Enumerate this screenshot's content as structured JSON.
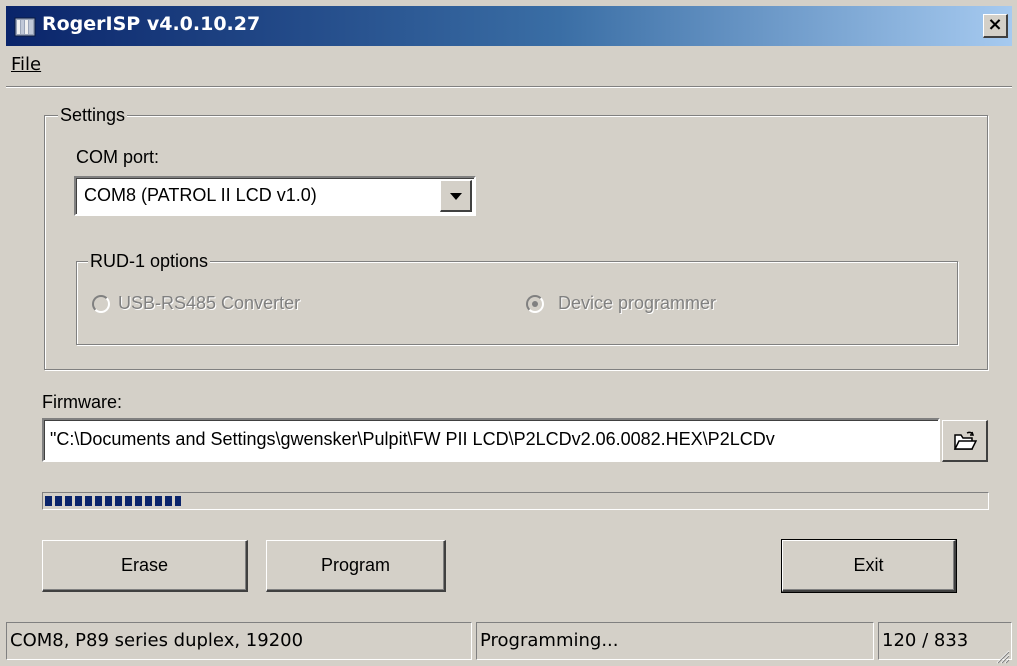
{
  "window": {
    "title": "RogerISP v4.0.10.27",
    "close_label": "×"
  },
  "menu": {
    "file": "File"
  },
  "settings": {
    "group_label": "Settings",
    "com_port_label": "COM port:",
    "com_port_value": "COM8 (PATROL II LCD v1.0)",
    "rud_group_label": "RUD-1 options",
    "radio_usb": "USB-RS485 Converter",
    "radio_device": "Device programmer",
    "selected_option": "Device programmer"
  },
  "firmware": {
    "label": "Firmware:",
    "value": "\"C:\\Documents and Settings\\gwensker\\Pulpit\\FW PII LCD\\P2LCDv2.06.0082.HEX\\P2LCDv"
  },
  "progress": {
    "fraction": 0.144
  },
  "buttons": {
    "erase": "Erase",
    "program": "Program",
    "exit": "Exit"
  },
  "status": {
    "connection": "COM8, P89 series duplex, 19200",
    "state": "Programming...",
    "count": "120 / 833"
  },
  "icons": {
    "app": "app-icon",
    "browse": "folder-open-icon",
    "dropdown": "chevron-down-icon"
  }
}
